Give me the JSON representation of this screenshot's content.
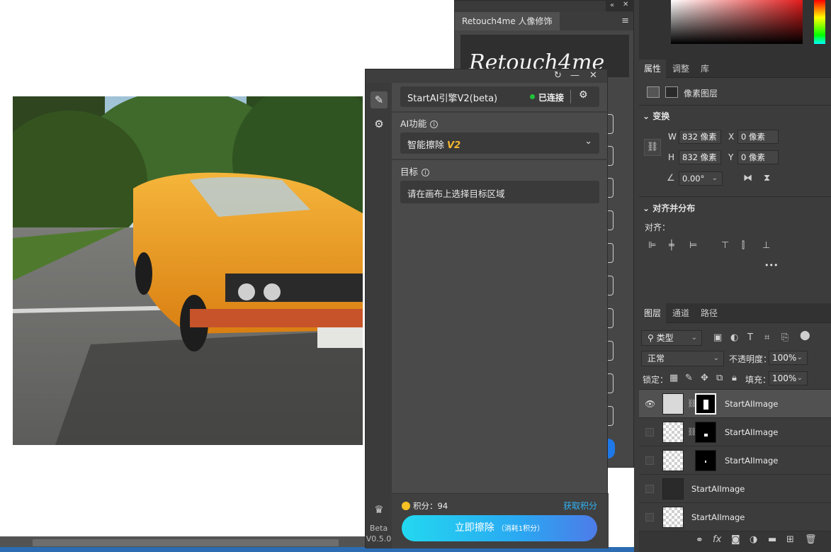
{
  "retouch_panel": {
    "tab_title": "Retouch4me 人像修饰",
    "logo_text": "Retouch4me"
  },
  "startai": {
    "engine": {
      "name": "StartAI引擎V2(beta)",
      "status": "已连接",
      "status_color": "#21c13b"
    },
    "ai_function": {
      "label": "AI功能",
      "selected": "智能擦除",
      "selected_badge": "V2"
    },
    "target": {
      "label": "目标",
      "placeholder": "请在画布上选择目标区域"
    },
    "footer": {
      "points_label": "积分：",
      "points_value": "94",
      "get_points": "获取积分",
      "action_label": "立即擦除",
      "action_cost": "（消耗1积分）"
    },
    "sidebar": {
      "beta": "Beta",
      "version": "V0.5.0"
    }
  },
  "photoshop": {
    "properties_tabs": [
      "属性",
      "调整",
      "库"
    ],
    "layer_type": "像素图层",
    "transform": {
      "title": "变换",
      "w_label": "W",
      "w_value": "832 像素",
      "h_label": "H",
      "h_value": "832 像素",
      "x_label": "X",
      "x_value": "0 像素",
      "y_label": "Y",
      "y_value": "0 像素",
      "angle_value": "0.00°"
    },
    "align": {
      "title": "对齐并分布",
      "label": "对齐：",
      "more": "•••"
    },
    "layers_tabs": [
      "图层",
      "通道",
      "路径"
    ],
    "filter_kind": "类型",
    "blend_mode": "正常",
    "opacity_label": "不透明度：",
    "opacity_value": "100%",
    "lock_label": "锁定：",
    "fill_label": "填充：",
    "fill_value": "100%",
    "layers": [
      {
        "name": "StartAIImage"
      },
      {
        "name": "StartAIImage"
      },
      {
        "name": "StartAIImage"
      },
      {
        "name": "StartAIImage"
      },
      {
        "name": "StartAIImage"
      }
    ]
  }
}
